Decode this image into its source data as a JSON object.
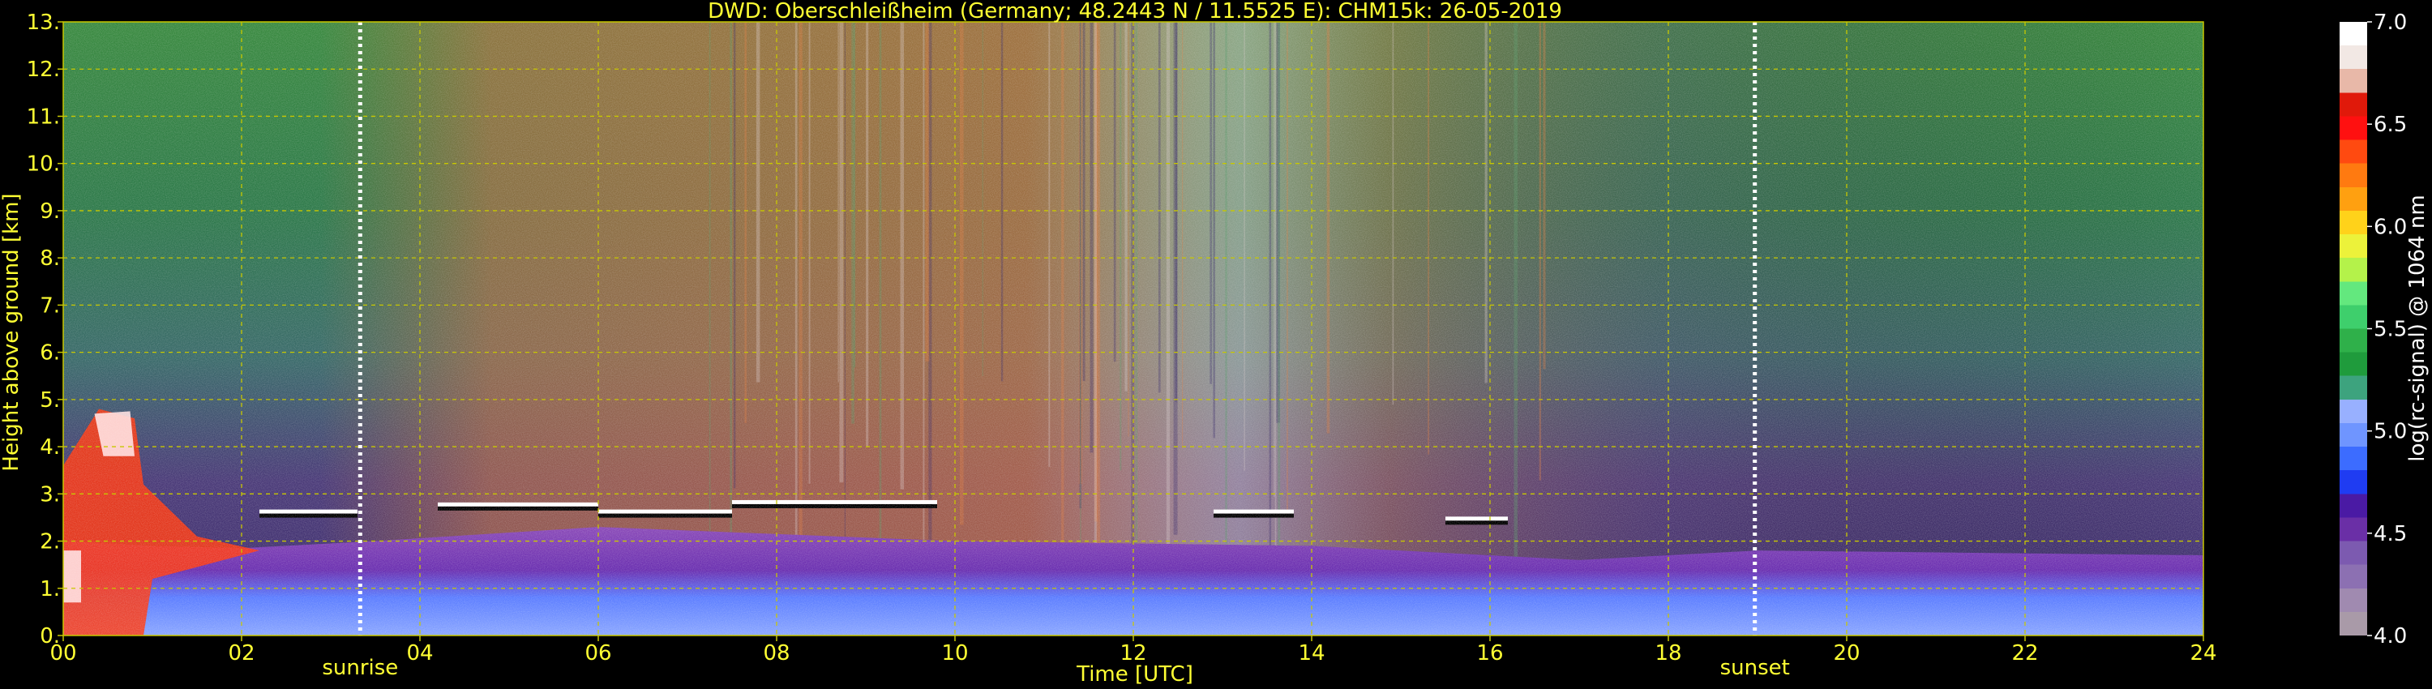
{
  "chart_data": {
    "type": "heatmap",
    "title": "DWD: Oberschleißheim (Germany; 48.2443 N / 11.5525 E):    CHM15k: 26-05-2019",
    "xlabel": "Time [UTC]",
    "ylabel": "Height above ground [km]",
    "xlim": [
      0,
      24
    ],
    "ylim": [
      0,
      13
    ],
    "x_ticks": [
      "00",
      "02",
      "04",
      "06",
      "08",
      "10",
      "12",
      "14",
      "16",
      "18",
      "20",
      "22",
      "24"
    ],
    "y_ticks": [
      "0.",
      "1.",
      "2.",
      "3.",
      "4.",
      "5.",
      "6.",
      "7.",
      "8.",
      "9.",
      "10.",
      "11.",
      "12.",
      "13."
    ],
    "grid": true,
    "markers": [
      {
        "label": "sunrise",
        "time": 3.33
      },
      {
        "label": "sunset",
        "time": 18.97
      }
    ],
    "colorbar": {
      "label": "log(rc-signal) @ 1064 nm",
      "range": [
        4.0,
        7.0
      ],
      "ticks": [
        "4.0",
        "4.5",
        "5.0",
        "5.5",
        "6.0",
        "6.5",
        "7.0"
      ],
      "colors": [
        "#a99aa8",
        "#a08ab0",
        "#8c70b2",
        "#7c5ab0",
        "#6a2fa6",
        "#4a1aa4",
        "#1f3cf2",
        "#3c6cff",
        "#6f95ff",
        "#98b0ff",
        "#3da37e",
        "#1f9b3c",
        "#2fb04a",
        "#3ecf6c",
        "#63e87e",
        "#b4f24a",
        "#ecf23a",
        "#ffd21a",
        "#ffa010",
        "#ff7a10",
        "#ff4a10",
        "#ff1010",
        "#e0190a",
        "#e8b8a8",
        "#f2e8e4",
        "#ffffff"
      ]
    },
    "cloud_layers": [
      {
        "t0": 2.2,
        "t1": 3.3,
        "h": 2.6
      },
      {
        "t0": 4.2,
        "t1": 6.0,
        "h": 2.75
      },
      {
        "t0": 6.0,
        "t1": 7.5,
        "h": 2.6
      },
      {
        "t0": 7.5,
        "t1": 9.8,
        "h": 2.8
      },
      {
        "t0": 12.9,
        "t1": 13.8,
        "h": 2.6
      },
      {
        "t0": 15.5,
        "t1": 16.2,
        "h": 2.45
      }
    ],
    "boundary_layer_top": [
      {
        "t": 0,
        "h": 2.0
      },
      {
        "t": 1,
        "h": 1.9
      },
      {
        "t": 2,
        "h": 1.85
      },
      {
        "t": 3.5,
        "h": 2.0
      },
      {
        "t": 6,
        "h": 2.3
      },
      {
        "t": 10,
        "h": 2.0
      },
      {
        "t": 14,
        "h": 1.9
      },
      {
        "t": 17,
        "h": 1.6
      },
      {
        "t": 19,
        "h": 1.8
      },
      {
        "t": 24,
        "h": 1.7
      }
    ]
  }
}
